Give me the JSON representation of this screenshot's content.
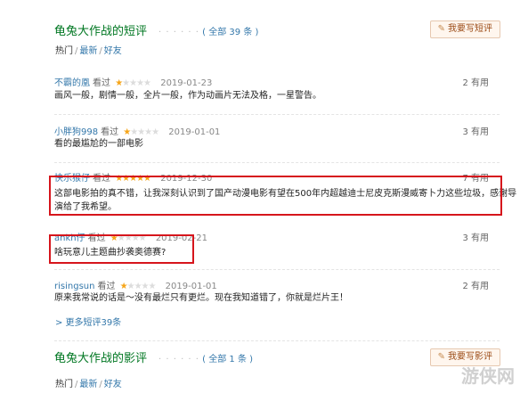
{
  "short_comments": {
    "title": "龟兔大作战的短评",
    "dots": "· · · · · ·",
    "count": "( 全部 39 条 )",
    "write_button": "我要写短评",
    "sort": {
      "hot": "热门",
      "sep": "/",
      "latest": "最新",
      "friends": "好友"
    },
    "items": [
      {
        "user": "不霸的凰",
        "watched": "看过",
        "rating": 1,
        "date": "2019-01-23",
        "useful": "2 有用",
        "content_lines": [
          "画风一般，剧情一般，全片一般，作为动画片无法及格，一星警告。"
        ]
      },
      {
        "user": "小胖狗998",
        "watched": "看过",
        "rating": 1,
        "date": "2019-01-01",
        "useful": "3 有用",
        "content_lines": [
          "看的最尴尬的一部电影"
        ]
      },
      {
        "user": "快乐猴仔",
        "watched": "看过",
        "rating": 5,
        "date": "2019-12-30",
        "useful": "7 有用",
        "content_lines": [
          "这部电影拍的真不错，让我深刻认识到了国产动漫电影有望在500年内超越迪士尼皮克斯漫威寄卜力这些垃圾，感谢导",
          "演给了我希望。"
        ]
      },
      {
        "user": "ankh仔",
        "watched": "看过",
        "rating": 1,
        "date": "2019-02-21",
        "useful": "3 有用",
        "content_lines": [
          "啥玩意儿主题曲抄袭奥德赛?"
        ]
      },
      {
        "user": "risingsun",
        "watched": "看过",
        "rating": 1,
        "date": "2019-01-01",
        "useful": "2 有用",
        "content_lines": [
          "原来我常说的话是～没有最烂只有更烂。现在我知道错了，你就是烂片王！"
        ]
      }
    ],
    "more": "> 更多短评39条"
  },
  "reviews": {
    "title": "龟兔大作战的影评",
    "dots": "· · · · · ·",
    "count": "( 全部 1 条 )",
    "write_button": "我要写影评",
    "sort": {
      "hot": "热门",
      "sep": "/",
      "latest": "最新",
      "friends": "好友"
    }
  },
  "watermark": "游侠网",
  "colors": {
    "link": "#3377aa",
    "title": "#007722",
    "star": "#f6a519",
    "highlight": "#d6151c"
  }
}
